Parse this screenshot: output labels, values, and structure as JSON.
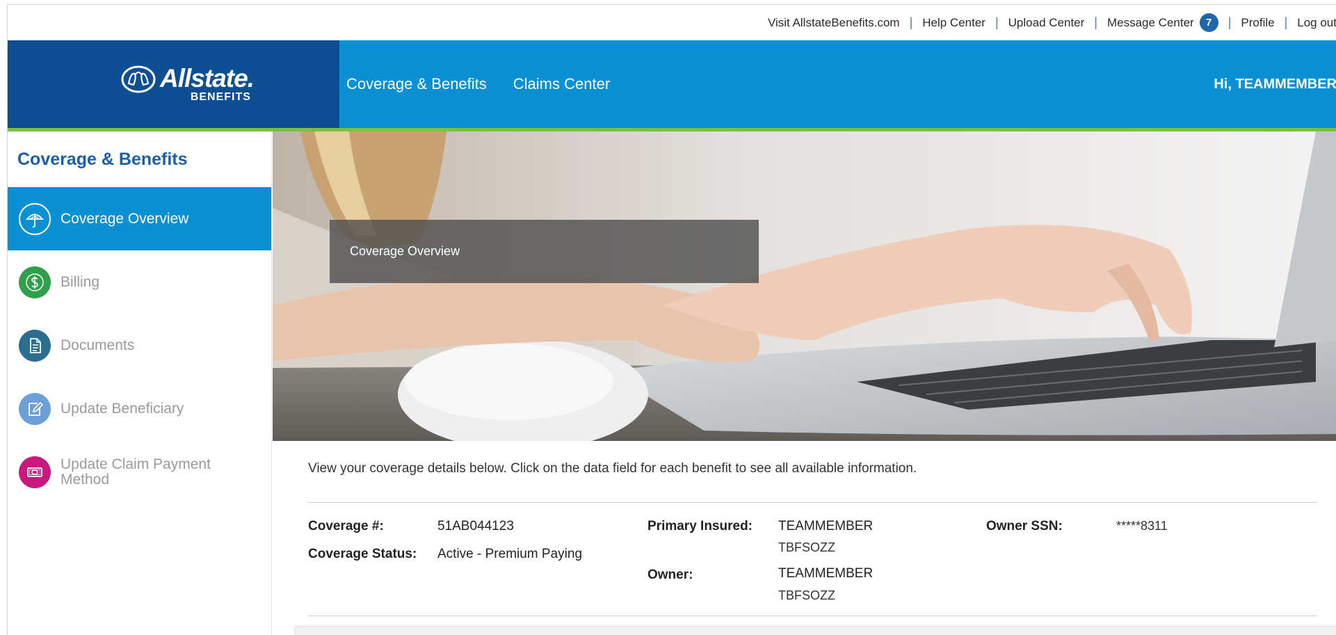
{
  "utility": {
    "links": {
      "visit": "Visit AllstateBenefits.com",
      "help": "Help Center",
      "upload": "Upload Center",
      "message": "Message Center",
      "profile": "Profile",
      "logout": "Log out"
    },
    "separator": "|",
    "message_count": "7"
  },
  "header": {
    "logo_word": "Allstate.",
    "logo_sub": "BENEFITS",
    "nav": [
      "Coverage & Benefits",
      "Claims Center"
    ],
    "greeting": "Hi, TEAMMEMBER"
  },
  "sidebar": {
    "title": "Coverage & Benefits",
    "items": [
      {
        "label": "Coverage Overview",
        "icon": "umbrella-icon",
        "color": "#0b90d4"
      },
      {
        "label": "Billing",
        "icon": "dollar-icon",
        "color": "#2ea04a"
      },
      {
        "label": "Documents",
        "icon": "document-icon",
        "color": "#2c6e8f"
      },
      {
        "label": "Update Beneficiary",
        "icon": "edit-icon",
        "color": "#6a9fd8"
      },
      {
        "label": "Update Claim Payment Method",
        "icon": "money-icon",
        "color": "#c8197f"
      }
    ]
  },
  "hero": {
    "title": "Coverage Overview"
  },
  "content": {
    "intro": "View your coverage details below. Click on the data field for each benefit to see all available information.",
    "coverage_number_label": "Coverage #:",
    "coverage_number": "51AB044123",
    "coverage_status_label": "Coverage Status:",
    "coverage_status": "Active - Premium Paying",
    "primary_insured_label": "Primary Insured:",
    "primary_insured_first": "TEAMMEMBER",
    "primary_insured_last": "TBFSOZZ",
    "owner_label": "Owner:",
    "owner_first": "TEAMMEMBER",
    "owner_last": "TBFSOZZ",
    "owner_ssn_label": "Owner SSN:",
    "owner_ssn": "*****8311"
  },
  "colors": {
    "header_blue": "#0b90d4",
    "logo_navy": "#0d4f92",
    "accent_green": "#7ac143",
    "title_blue": "#1a5fa8"
  }
}
